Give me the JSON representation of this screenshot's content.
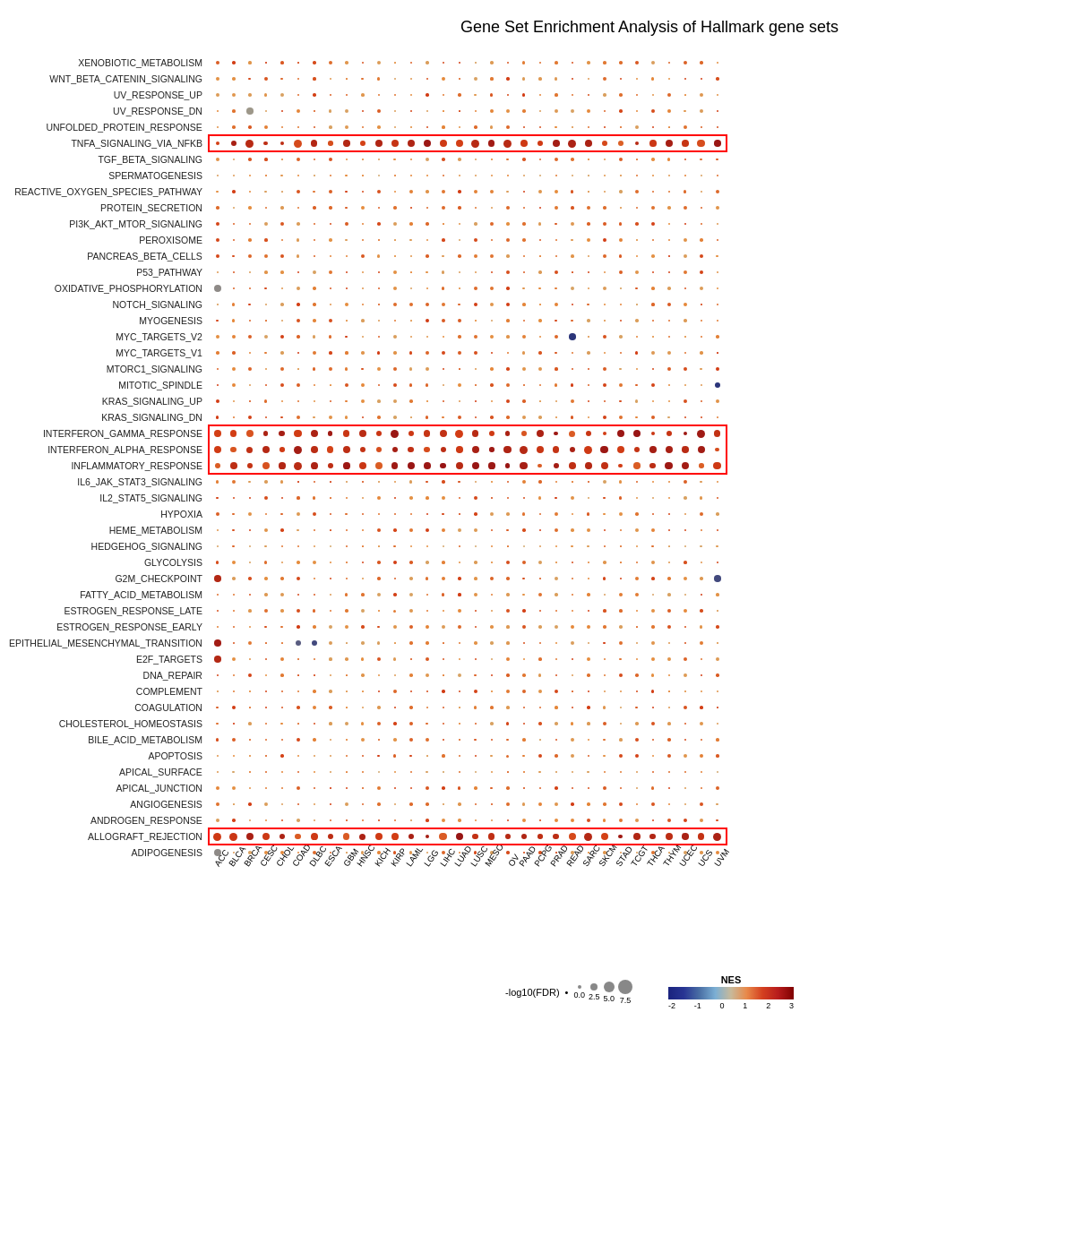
{
  "title": "Gene Set Enrichment Analysis of Hallmark gene sets",
  "rows": [
    "XENOBIOTIC_METABOLISM",
    "WNT_BETA_CATENIN_SIGNALING",
    "UV_RESPONSE_UP",
    "UV_RESPONSE_DN",
    "UNFOLDED_PROTEIN_RESPONSE",
    "TNFA_SIGNALING_VIA_NFKB",
    "TGF_BETA_SIGNALING",
    "SPERMATOGENESIS",
    "REACTIVE_OXYGEN_SPECIES_PATHWAY",
    "PROTEIN_SECRETION",
    "PI3K_AKT_MTOR_SIGNALING",
    "PEROXISOME",
    "PANCREAS_BETA_CELLS",
    "P53_PATHWAY",
    "OXIDATIVE_PHOSPHORYLATION",
    "NOTCH_SIGNALING",
    "MYOGENESIS",
    "MYC_TARGETS_V2",
    "MYC_TARGETS_V1",
    "MTORC1_SIGNALING",
    "MITOTIC_SPINDLE",
    "KRAS_SIGNALING_UP",
    "KRAS_SIGNALING_DN",
    "INTERFERON_GAMMA_RESPONSE",
    "INTERFERON_ALPHA_RESPONSE",
    "INFLAMMATORY_RESPONSE",
    "IL6_JAK_STAT3_SIGNALING",
    "IL2_STAT5_SIGNALING",
    "HYPOXIA",
    "HEME_METABOLISM",
    "HEDGEHOG_SIGNALING",
    "GLYCOLYSIS",
    "G2M_CHECKPOINT",
    "FATTY_ACID_METABOLISM",
    "ESTROGEN_RESPONSE_LATE",
    "ESTROGEN_RESPONSE_EARLY",
    "EPITHELIAL_MESENCHYMAL_TRANSITION",
    "E2F_TARGETS",
    "DNA_REPAIR",
    "COMPLEMENT",
    "COAGULATION",
    "CHOLESTEROL_HOMEOSTASIS",
    "BILE_ACID_METABOLISM",
    "APOPTOSIS",
    "APICAL_SURFACE",
    "APICAL_JUNCTION",
    "ANGIOGENESIS",
    "ANDROGEN_RESPONSE",
    "ALLOGRAFT_REJECTION",
    "ADIPOGENESIS"
  ],
  "cols": [
    "ACC",
    "BLCA",
    "BRCA",
    "CESC",
    "CHOL",
    "COAD",
    "DLBC",
    "ESCA",
    "GBM",
    "HNSC",
    "KICH",
    "KIRP",
    "LAML",
    "LGG",
    "LIHC",
    "LUAD",
    "LUSC",
    "MESO",
    "OV",
    "PAAD",
    "PCPG",
    "PRAD",
    "READ",
    "SARC",
    "SKCM",
    "STAD",
    "TCGT",
    "THCA",
    "THYM",
    "UCEC",
    "UCS",
    "UVM"
  ],
  "highlighted_row_groups": [
    {
      "label": "TNFA_SIGNALING_VIA_NFKB",
      "row_index": 5,
      "rows_count": 1
    },
    {
      "label": "INTERFERON_GAMMA_RESPONSE to INFLAMMATORY_RESPONSE",
      "row_index": 23,
      "rows_count": 3
    },
    {
      "label": "ALLOGRAFT_REJECTION",
      "row_index": 48,
      "rows_count": 1
    }
  ],
  "legend": {
    "fdr_label": "-log10(FDR)",
    "fdr_sizes": [
      {
        "label": "0.0",
        "size": 2
      },
      {
        "label": "2.5",
        "size": 5
      },
      {
        "label": "5.0",
        "size": 8
      },
      {
        "label": "7.5",
        "size": 11
      }
    ],
    "nes_label": "NES",
    "nes_values": [
      "-2",
      "-1",
      "0",
      "1",
      "2",
      "3"
    ]
  }
}
